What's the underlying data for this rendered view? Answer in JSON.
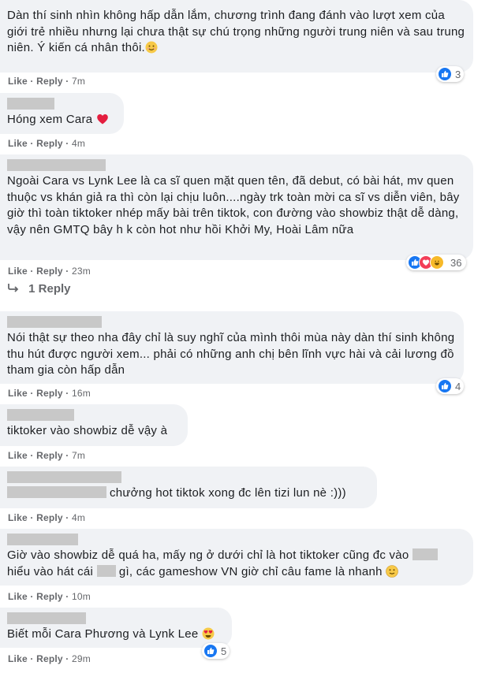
{
  "comments": [
    {
      "text": "Dàn thí sinh nhìn không hấp dẫn lắm, chương trình đang đánh vào lượt xem của giới trẻ nhiều nhưng lại chưa thật sự chú trọng những người trung niên và sau trung niên. Ý kiến cá nhân thôi.",
      "emoji": "smiling-face",
      "like": "Like",
      "reply": "Reply",
      "time": "7m",
      "reactions": {
        "icons": [
          "like"
        ],
        "count": "3"
      }
    },
    {
      "text": "Hóng xem Cara",
      "emoji": "red-heart",
      "like": "Like",
      "reply": "Reply",
      "time": "4m"
    },
    {
      "text": "Ngoài Cara vs Lynk Lee là ca sĩ quen mặt quen tên, đã debut, có bài hát, mv quen thuộc vs khán giả ra thì còn lại chịu luôn....ngày trk toàn mời ca sĩ vs diễn viên, bây giờ thì toàn tiktoker nhép mấy bài trên tiktok, con đường vào showbiz thật dễ dàng, vậy nên GMTQ bây h k còn hot như hồi Khởi My, Hoài Lâm nữa",
      "like": "Like",
      "reply": "Reply",
      "time": "23m",
      "reactions": {
        "icons": [
          "like",
          "love",
          "haha"
        ],
        "count": "36"
      },
      "replies_link": "1 Reply"
    },
    {
      "text": "Nói thật sự theo nha đây chỉ là suy nghĩ của mình thôi mùa này dàn thí sinh không thu hút được người xem... phải có những anh chị bên lĩnh vực hài và cải lương đồ tham gia còn hấp dẫn",
      "like": "Like",
      "reply": "Reply",
      "time": "16m",
      "reactions": {
        "icons": [
          "like"
        ],
        "count": "4"
      }
    },
    {
      "text": "tiktoker vào showbiz dễ vậy à",
      "like": "Like",
      "reply": "Reply",
      "time": "7m"
    },
    {
      "text_after": "chưởng hot tiktok xong đc lên tizi lun nè :)))",
      "like": "Like",
      "reply": "Reply",
      "time": "4m"
    },
    {
      "line1": "Giờ vào showbiz dễ quá ha, mấy ng ở dưới chỉ là hot tiktoker cũng đc vào",
      "line2a": "hiểu vào hát cái",
      "line2b": "gì, các gameshow VN giờ chỉ câu fame là nhanh",
      "emoji": "slightly-smiling-face",
      "like": "Like",
      "reply": "Reply",
      "time": "10m"
    },
    {
      "text": "Biết mỗi Cara Phương và Lynk Lee",
      "emoji": "heart-eyes-face",
      "like": "Like",
      "reply": "Reply",
      "time": "29m",
      "reactions": {
        "icons": [
          "like"
        ],
        "count": "5"
      }
    }
  ],
  "colors": {
    "bubble": "#f0f2f5",
    "meta": "#65676b",
    "like_blue": "#1877f2",
    "love_red": "#f33e58",
    "haha_yellow": "#f7b928"
  }
}
